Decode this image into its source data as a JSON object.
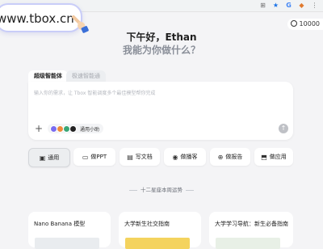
{
  "browser": {
    "icons": [
      "translate-icon",
      "star-icon",
      "g-icon",
      "shield-icon",
      "extensions-icon"
    ]
  },
  "url": {
    "text": "www.tbox.cn"
  },
  "counter": {
    "value": "10000"
  },
  "greeting": {
    "title": "下午好，Ethan",
    "subtitle": "我能为你做什么？"
  },
  "tabs": [
    {
      "label": "超级智能体",
      "active": true
    },
    {
      "label": "极速智能通",
      "active": false
    }
  ],
  "prompt": {
    "placeholder": "输入你的需求，让 Tbox 智能调度多个最佳模型帮你完成",
    "model_chip": "通用小助",
    "model_colors": [
      "#7a6cf0",
      "#f08a3c",
      "#3aa676",
      "#222222"
    ]
  },
  "modes": [
    {
      "label": "通用",
      "icon": "general-icon",
      "active": true
    },
    {
      "label": "做PPT",
      "icon": "ppt-icon",
      "active": false
    },
    {
      "label": "写文档",
      "icon": "document-icon",
      "active": false
    },
    {
      "label": "做播客",
      "icon": "podcast-icon",
      "active": false
    },
    {
      "label": "做报告",
      "icon": "report-icon",
      "active": false
    },
    {
      "label": "做应用",
      "icon": "app-icon",
      "active": false
    }
  ],
  "trend": {
    "text": "十二星座本周运势"
  },
  "cards": [
    {
      "title": "Nano Banana 模型",
      "thumb_color": "#e9ecef"
    },
    {
      "title": "大学新生社交指南",
      "thumb_color": "#f4d35e"
    },
    {
      "title": "大学学习导航：新生必备指南",
      "thumb_color": "#e8f0e6"
    }
  ],
  "colors": {
    "accent": "#1a73e8",
    "border": "#c9cdf8"
  }
}
